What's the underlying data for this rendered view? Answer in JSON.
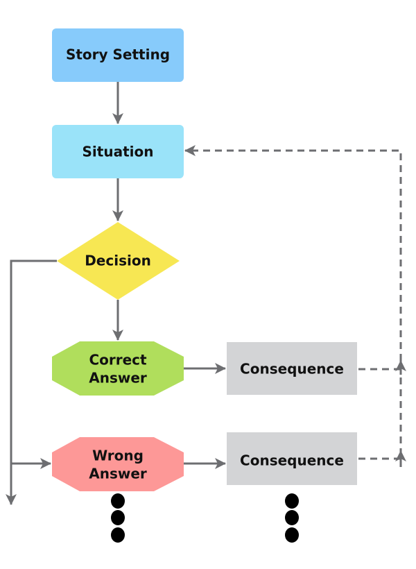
{
  "nodes": {
    "story_setting": {
      "label": "Story Setting",
      "color": "#87cbfb"
    },
    "situation": {
      "label": "Situation",
      "color": "#9ae3f9"
    },
    "decision": {
      "label": "Decision",
      "color": "#f7e753"
    },
    "correct_answer": {
      "line1": "Correct",
      "line2": "Answer",
      "color": "#b0de5c"
    },
    "wrong_answer": {
      "line1": "Wrong",
      "line2": "Answer",
      "color": "#fd9897"
    },
    "consequence_correct": {
      "label": "Consequence",
      "color": "#d3d4d6"
    },
    "consequence_wrong": {
      "label": "Consequence",
      "color": "#d3d4d6"
    }
  },
  "colors": {
    "arrow": "#6d6e71",
    "dots": "#000000"
  }
}
